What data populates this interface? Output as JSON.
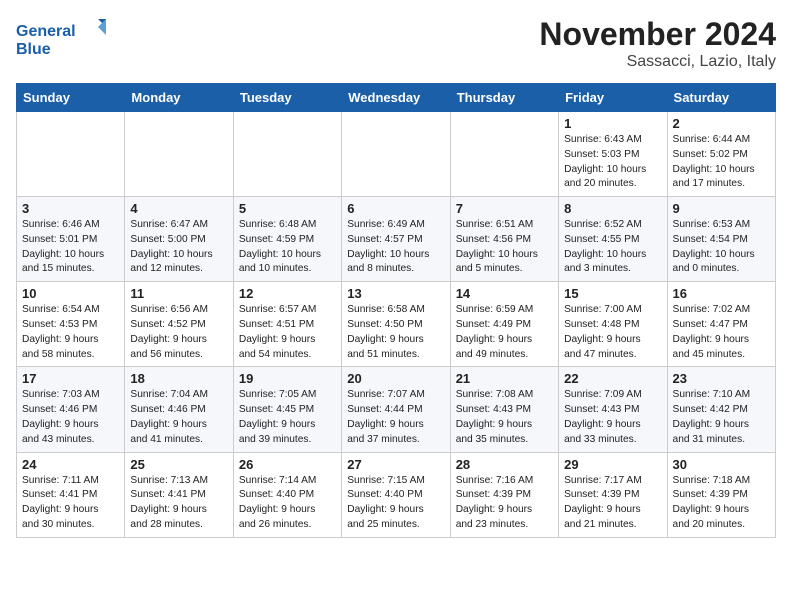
{
  "header": {
    "logo_line1": "General",
    "logo_line2": "Blue",
    "title": "November 2024",
    "subtitle": "Sassacci, Lazio, Italy"
  },
  "columns": [
    "Sunday",
    "Monday",
    "Tuesday",
    "Wednesday",
    "Thursday",
    "Friday",
    "Saturday"
  ],
  "weeks": [
    {
      "days": [
        {
          "num": "",
          "info": ""
        },
        {
          "num": "",
          "info": ""
        },
        {
          "num": "",
          "info": ""
        },
        {
          "num": "",
          "info": ""
        },
        {
          "num": "",
          "info": ""
        },
        {
          "num": "1",
          "info": "Sunrise: 6:43 AM\nSunset: 5:03 PM\nDaylight: 10 hours\nand 20 minutes."
        },
        {
          "num": "2",
          "info": "Sunrise: 6:44 AM\nSunset: 5:02 PM\nDaylight: 10 hours\nand 17 minutes."
        }
      ]
    },
    {
      "days": [
        {
          "num": "3",
          "info": "Sunrise: 6:46 AM\nSunset: 5:01 PM\nDaylight: 10 hours\nand 15 minutes."
        },
        {
          "num": "4",
          "info": "Sunrise: 6:47 AM\nSunset: 5:00 PM\nDaylight: 10 hours\nand 12 minutes."
        },
        {
          "num": "5",
          "info": "Sunrise: 6:48 AM\nSunset: 4:59 PM\nDaylight: 10 hours\nand 10 minutes."
        },
        {
          "num": "6",
          "info": "Sunrise: 6:49 AM\nSunset: 4:57 PM\nDaylight: 10 hours\nand 8 minutes."
        },
        {
          "num": "7",
          "info": "Sunrise: 6:51 AM\nSunset: 4:56 PM\nDaylight: 10 hours\nand 5 minutes."
        },
        {
          "num": "8",
          "info": "Sunrise: 6:52 AM\nSunset: 4:55 PM\nDaylight: 10 hours\nand 3 minutes."
        },
        {
          "num": "9",
          "info": "Sunrise: 6:53 AM\nSunset: 4:54 PM\nDaylight: 10 hours\nand 0 minutes."
        }
      ]
    },
    {
      "days": [
        {
          "num": "10",
          "info": "Sunrise: 6:54 AM\nSunset: 4:53 PM\nDaylight: 9 hours\nand 58 minutes."
        },
        {
          "num": "11",
          "info": "Sunrise: 6:56 AM\nSunset: 4:52 PM\nDaylight: 9 hours\nand 56 minutes."
        },
        {
          "num": "12",
          "info": "Sunrise: 6:57 AM\nSunset: 4:51 PM\nDaylight: 9 hours\nand 54 minutes."
        },
        {
          "num": "13",
          "info": "Sunrise: 6:58 AM\nSunset: 4:50 PM\nDaylight: 9 hours\nand 51 minutes."
        },
        {
          "num": "14",
          "info": "Sunrise: 6:59 AM\nSunset: 4:49 PM\nDaylight: 9 hours\nand 49 minutes."
        },
        {
          "num": "15",
          "info": "Sunrise: 7:00 AM\nSunset: 4:48 PM\nDaylight: 9 hours\nand 47 minutes."
        },
        {
          "num": "16",
          "info": "Sunrise: 7:02 AM\nSunset: 4:47 PM\nDaylight: 9 hours\nand 45 minutes."
        }
      ]
    },
    {
      "days": [
        {
          "num": "17",
          "info": "Sunrise: 7:03 AM\nSunset: 4:46 PM\nDaylight: 9 hours\nand 43 minutes."
        },
        {
          "num": "18",
          "info": "Sunrise: 7:04 AM\nSunset: 4:46 PM\nDaylight: 9 hours\nand 41 minutes."
        },
        {
          "num": "19",
          "info": "Sunrise: 7:05 AM\nSunset: 4:45 PM\nDaylight: 9 hours\nand 39 minutes."
        },
        {
          "num": "20",
          "info": "Sunrise: 7:07 AM\nSunset: 4:44 PM\nDaylight: 9 hours\nand 37 minutes."
        },
        {
          "num": "21",
          "info": "Sunrise: 7:08 AM\nSunset: 4:43 PM\nDaylight: 9 hours\nand 35 minutes."
        },
        {
          "num": "22",
          "info": "Sunrise: 7:09 AM\nSunset: 4:43 PM\nDaylight: 9 hours\nand 33 minutes."
        },
        {
          "num": "23",
          "info": "Sunrise: 7:10 AM\nSunset: 4:42 PM\nDaylight: 9 hours\nand 31 minutes."
        }
      ]
    },
    {
      "days": [
        {
          "num": "24",
          "info": "Sunrise: 7:11 AM\nSunset: 4:41 PM\nDaylight: 9 hours\nand 30 minutes."
        },
        {
          "num": "25",
          "info": "Sunrise: 7:13 AM\nSunset: 4:41 PM\nDaylight: 9 hours\nand 28 minutes."
        },
        {
          "num": "26",
          "info": "Sunrise: 7:14 AM\nSunset: 4:40 PM\nDaylight: 9 hours\nand 26 minutes."
        },
        {
          "num": "27",
          "info": "Sunrise: 7:15 AM\nSunset: 4:40 PM\nDaylight: 9 hours\nand 25 minutes."
        },
        {
          "num": "28",
          "info": "Sunrise: 7:16 AM\nSunset: 4:39 PM\nDaylight: 9 hours\nand 23 minutes."
        },
        {
          "num": "29",
          "info": "Sunrise: 7:17 AM\nSunset: 4:39 PM\nDaylight: 9 hours\nand 21 minutes."
        },
        {
          "num": "30",
          "info": "Sunrise: 7:18 AM\nSunset: 4:39 PM\nDaylight: 9 hours\nand 20 minutes."
        }
      ]
    }
  ]
}
